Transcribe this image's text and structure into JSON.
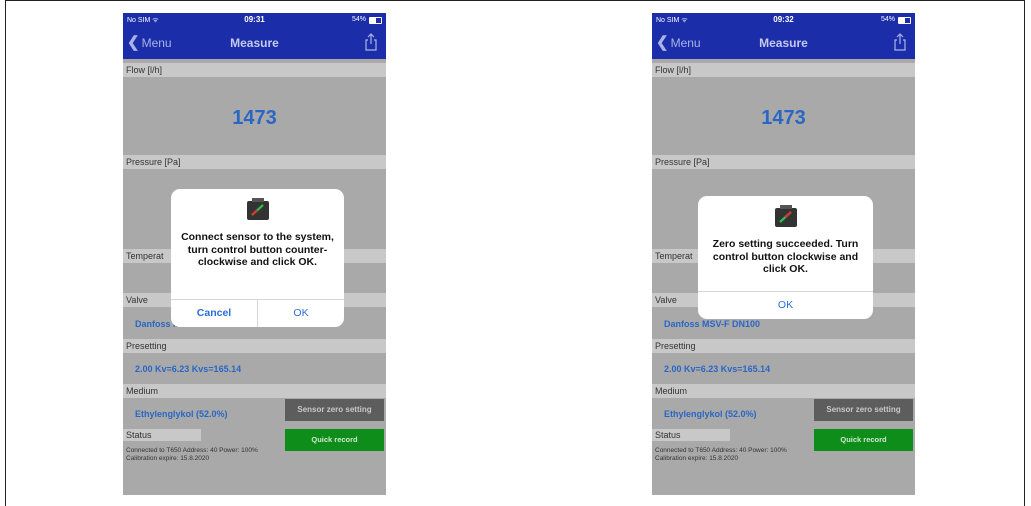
{
  "screens": [
    {
      "status_bar": {
        "carrier": "No SIM ᯤ",
        "time": "09:31",
        "battery": "54%"
      },
      "nav": {
        "back": "Menu",
        "title": "Measure"
      },
      "flow": {
        "label": "Flow [l/h]",
        "value": "1473"
      },
      "pressure": {
        "label": "Pressure [Pa]"
      },
      "temperature": {
        "label": "Temperat"
      },
      "valve": {
        "label": "Valve",
        "value": "Danfoss MSV-F DN100"
      },
      "presetting": {
        "label": "Presetting",
        "value": "2.00 Kv=6.23 Kvs=165.14"
      },
      "medium": {
        "label": "Medium",
        "value": "Ethylenglykol (52.0%)"
      },
      "status": {
        "label": "Status",
        "text": "Connected to T650 Address: 40 Power: 100% Calibration expire: 15.8.2020"
      },
      "buttons": {
        "sensor_zero": "Sensor zero setting",
        "quick_record": "Quick record"
      },
      "dialog": {
        "message": "Connect sensor to the system, turn control button counter-clockwise and click OK.",
        "cancel": "Cancel",
        "ok": "OK"
      }
    },
    {
      "status_bar": {
        "carrier": "No SIM ᯤ",
        "time": "09:32",
        "battery": "54%"
      },
      "nav": {
        "back": "Menu",
        "title": "Measure"
      },
      "flow": {
        "label": "Flow [l/h]",
        "value": "1473"
      },
      "pressure": {
        "label": "Pressure [Pa]"
      },
      "temperature": {
        "label": "Temperat"
      },
      "valve": {
        "label": "Valve",
        "value": "Danfoss MSV-F DN100"
      },
      "presetting": {
        "label": "Presetting",
        "value": "2.00 Kv=6.23 Kvs=165.14"
      },
      "medium": {
        "label": "Medium",
        "value": "Ethylenglykol (52.0%)"
      },
      "status": {
        "label": "Status",
        "text": "Connected to T650 Address: 40 Power: 100% Calibration expire: 15.8.2020"
      },
      "buttons": {
        "sensor_zero": "Sensor zero setting",
        "quick_record": "Quick record"
      },
      "dialog": {
        "message": "Zero setting succeeded. Turn control button clockwise and click OK.",
        "ok": "OK"
      }
    }
  ],
  "battery_level": 0.54,
  "colors": {
    "nav_bar": "#1b2da9",
    "value_text": "#2a66c4",
    "quick_record": "#0f8d1a",
    "sensor_zero": "#5d5d5d",
    "dialog_button": "#2a6fd8"
  },
  "icons": [
    "wifi-icon",
    "battery-icon",
    "chevron-left-icon",
    "share-icon",
    "sensor-device-icon"
  ]
}
